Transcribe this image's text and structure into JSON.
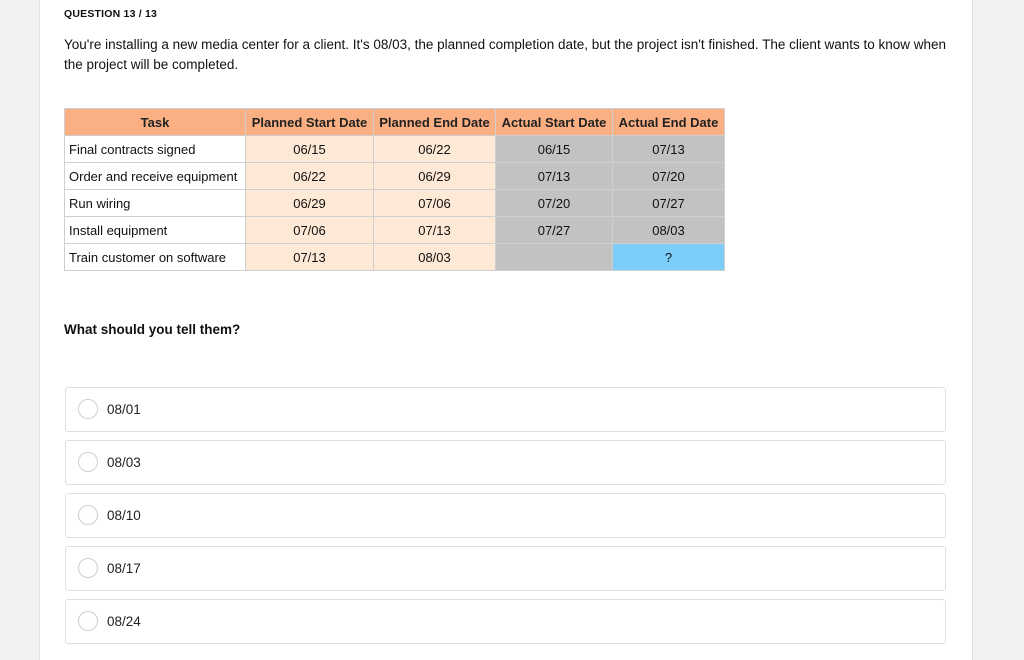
{
  "question": {
    "number_label": "QUESTION 13 / 13",
    "prompt": "You're installing a new media center for a client. It's 08/03, the planned completion date, but the project isn't finished. The client wants to know when the project will be completed.",
    "ask": "What should you tell them?"
  },
  "table": {
    "headers": [
      "Task",
      "Planned Start Date",
      "Planned End Date",
      "Actual Start Date",
      "Actual End Date"
    ],
    "rows": [
      [
        "Final contracts signed",
        "06/15",
        "06/22",
        "06/15",
        "07/13"
      ],
      [
        "Order and receive equipment",
        "06/22",
        "06/29",
        "07/13",
        "07/20"
      ],
      [
        "Run wiring",
        "06/29",
        "07/06",
        "07/20",
        "07/27"
      ],
      [
        "Install equipment",
        "07/06",
        "07/13",
        "07/27",
        "08/03"
      ],
      [
        "Train customer on software",
        "07/13",
        "08/03",
        "",
        "?"
      ]
    ]
  },
  "options": [
    "08/01",
    "08/03",
    "08/10",
    "08/17",
    "08/24"
  ],
  "colors": {
    "header": "#fbb084",
    "planned": "#fde9d5",
    "actual": "#c2c2c2",
    "unknown": "#7ccdfa"
  }
}
